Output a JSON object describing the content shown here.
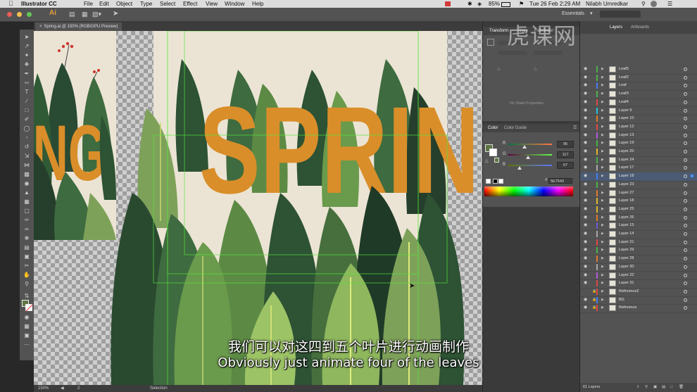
{
  "menubar": {
    "app": "Illustrator CC",
    "menus": [
      "File",
      "Edit",
      "Object",
      "Type",
      "Select",
      "Effect",
      "View",
      "Window",
      "Help"
    ],
    "battery": "85%",
    "datetime": "Tue 26 Feb  2:29 AM",
    "user": "Nilabh Umredkar"
  },
  "control": {
    "logo": "Ai",
    "workspace": "Essentials"
  },
  "document": {
    "tab": "Spring.ai @ 150% (RGB/GPU Preview)",
    "artwork_text": "SPRING"
  },
  "status": {
    "zoom": "150%",
    "artboard": "2",
    "tool": "Selection"
  },
  "transform_panel": {
    "tabs": [
      "Transform",
      "Align",
      "Pathfinder"
    ],
    "empty_text": "No State Properties"
  },
  "color_panel": {
    "tabs": [
      "Color",
      "Color Guide"
    ],
    "channels": [
      {
        "label": "R",
        "value": "96",
        "fraction": 0.376
      },
      {
        "label": "G",
        "value": "117",
        "fraction": 0.459
      },
      {
        "label": "B",
        "value": "67",
        "fraction": 0.263
      }
    ],
    "hex": "5E7543",
    "fill_color": "#5E7543"
  },
  "layers_panel": {
    "tabs": [
      "Layers",
      "Artboards"
    ],
    "footer": "61 Layers",
    "layers": [
      {
        "name": "Leaf5",
        "color": "#4ab04a",
        "selected": false,
        "locked": false,
        "visible": true
      },
      {
        "name": "Leaf2",
        "color": "#4ab04a",
        "selected": false,
        "locked": false,
        "visible": true
      },
      {
        "name": "Leaf",
        "color": "#4a7ff0",
        "selected": false,
        "locked": false,
        "visible": true
      },
      {
        "name": "Leaf3",
        "color": "#4ab04a",
        "selected": false,
        "locked": false,
        "visible": true
      },
      {
        "name": "Leaf4",
        "color": "#e04646",
        "selected": false,
        "locked": false,
        "visible": true
      },
      {
        "name": "Layer 9",
        "color": "#29c0d6",
        "selected": false,
        "locked": false,
        "visible": true
      },
      {
        "name": "Layer 10",
        "color": "#e07a2c",
        "selected": false,
        "locked": false,
        "visible": true
      },
      {
        "name": "Layer 12",
        "color": "#e04646",
        "selected": false,
        "locked": false,
        "visible": true
      },
      {
        "name": "Layer 13",
        "color": "#b15bd6",
        "selected": false,
        "locked": false,
        "visible": true
      },
      {
        "name": "Layer 19",
        "color": "#4ab04a",
        "selected": false,
        "locked": false,
        "visible": true
      },
      {
        "name": "Layer 20",
        "color": "#e0b82c",
        "selected": false,
        "locked": false,
        "visible": true
      },
      {
        "name": "Layer 24",
        "color": "#4ab04a",
        "selected": false,
        "locked": false,
        "visible": true
      },
      {
        "name": "Layer 17",
        "color": "#a7a7a7",
        "selected": false,
        "locked": false,
        "visible": true
      },
      {
        "name": "Layer 18",
        "color": "#4a7ff0",
        "selected": true,
        "locked": false,
        "visible": true
      },
      {
        "name": "Layer 23",
        "color": "#4ab04a",
        "selected": false,
        "locked": false,
        "visible": true
      },
      {
        "name": "Layer 27",
        "color": "#e07a2c",
        "selected": false,
        "locked": false,
        "visible": true
      },
      {
        "name": "Layer 18",
        "color": "#e0b82c",
        "selected": false,
        "locked": false,
        "visible": true
      },
      {
        "name": "Layer 25",
        "color": "#e0b82c",
        "selected": false,
        "locked": false,
        "visible": true
      },
      {
        "name": "Layer 26",
        "color": "#e07a2c",
        "selected": false,
        "locked": false,
        "visible": true
      },
      {
        "name": "Layer 15",
        "color": "#6b5bd6",
        "selected": false,
        "locked": false,
        "visible": true
      },
      {
        "name": "Layer 14",
        "color": "#a7a7a7",
        "selected": false,
        "locked": false,
        "visible": true
      },
      {
        "name": "Layer 21",
        "color": "#e04646",
        "selected": false,
        "locked": false,
        "visible": true
      },
      {
        "name": "Layer 29",
        "color": "#4ab04a",
        "selected": false,
        "locked": false,
        "visible": true
      },
      {
        "name": "Layer 28",
        "color": "#e07a2c",
        "selected": false,
        "locked": false,
        "visible": true
      },
      {
        "name": "Layer 30",
        "color": "#a7a7a7",
        "selected": false,
        "locked": false,
        "visible": true
      },
      {
        "name": "Layer 22",
        "color": "#b15bd6",
        "selected": false,
        "locked": false,
        "visible": true
      },
      {
        "name": "Layer 31",
        "color": "#e04646",
        "selected": false,
        "locked": false,
        "visible": true
      },
      {
        "name": "Reference2",
        "color": "#e04646",
        "selected": false,
        "locked": true,
        "visible": false
      },
      {
        "name": "BG",
        "color": "#4a7ff0",
        "selected": false,
        "locked": true,
        "visible": true
      },
      {
        "name": "Reference",
        "color": "#e04646",
        "selected": false,
        "locked": true,
        "visible": true
      }
    ]
  },
  "subtitles": {
    "chinese": "我们可以对这四到五个叶片进行动画制作",
    "english": "Obviously just animate four of the leaves"
  },
  "watermark": "虎课网"
}
